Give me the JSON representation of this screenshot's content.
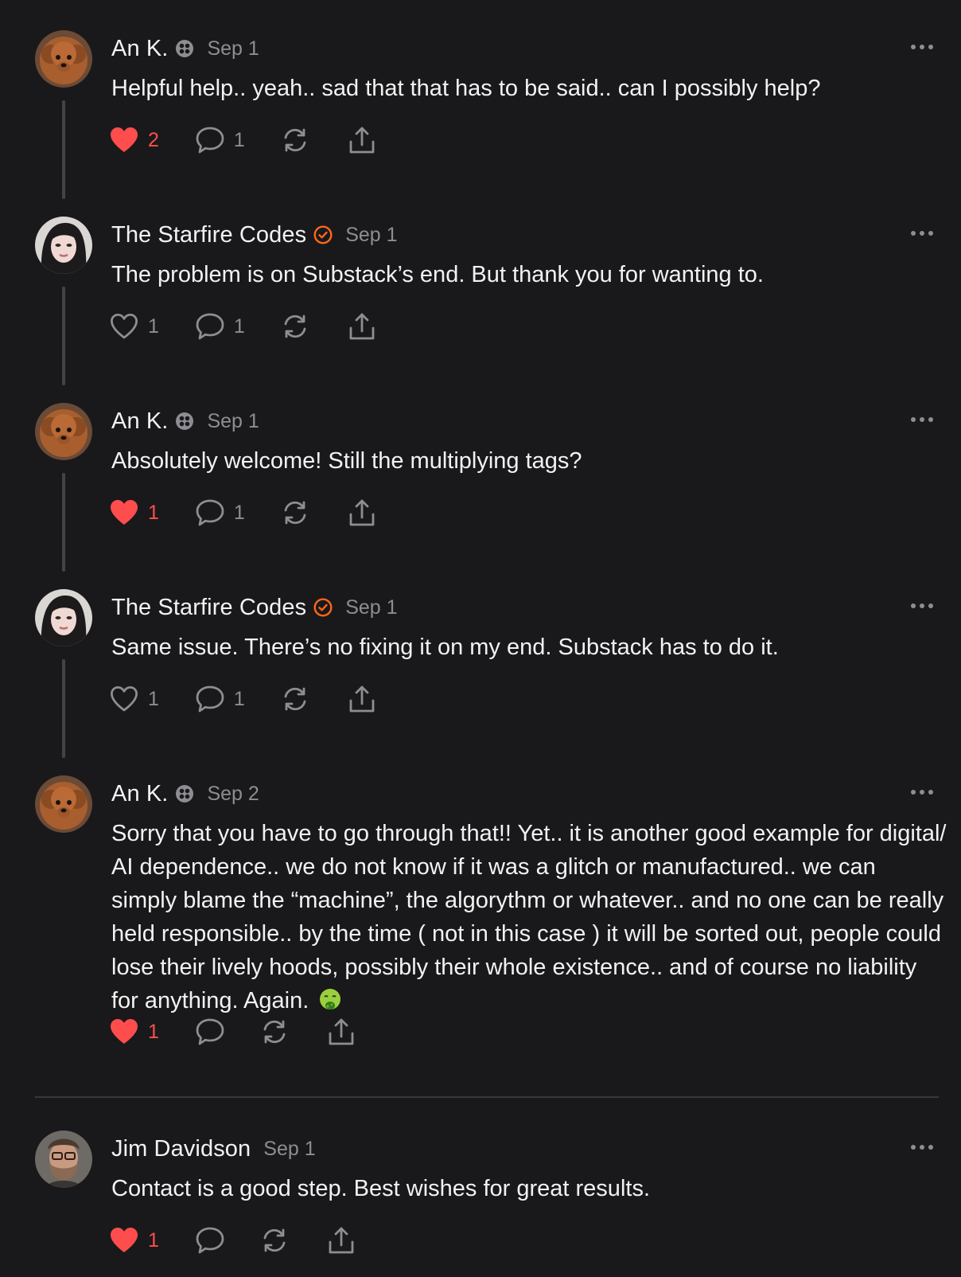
{
  "comments": [
    {
      "author": "An K.",
      "badge_icon": "pin-badge-icon",
      "date": "Sep 1",
      "text": "Helpful help.. yeah.. sad that that has to be said.. can I possibly help?",
      "likes": "2",
      "liked": true,
      "replies": "1",
      "avatar": "dog-avatar"
    },
    {
      "author": "The Starfire Codes",
      "badge_icon": "verified-check-icon",
      "date": "Sep 1",
      "text": "The problem is on Substack’s end. But thank you for wanting to.",
      "likes": "1",
      "liked": false,
      "replies": "1",
      "avatar": "woman-avatar"
    },
    {
      "author": "An K.",
      "badge_icon": "pin-badge-icon",
      "date": "Sep 1",
      "text": "Absolutely welcome! Still the multiplying tags?",
      "likes": "1",
      "liked": true,
      "replies": "1",
      "avatar": "dog-avatar"
    },
    {
      "author": "The Starfire Codes",
      "badge_icon": "verified-check-icon",
      "date": "Sep 1",
      "text": "Same issue. There’s no fixing it on my end. Substack has to do it.",
      "likes": "1",
      "liked": false,
      "replies": "1",
      "avatar": "woman-avatar"
    },
    {
      "author": "An K.",
      "badge_icon": "pin-badge-icon",
      "date": "Sep 2",
      "text": "Sorry that you have to go through that!! Yet.. it is another good example for digital/ AI dependence.. we do not know if it was a glitch or manufactured.. we can simply blame the “machine”, the algorythm or whatever.. and no one can be really held responsible.. by the time ( not in this case ) it will be sorted out, people could lose their lively hoods, possibly their whole existence.. and of course no liability for anything. Again.",
      "emoji": "nauseated-face-emoji",
      "likes": "1",
      "liked": true,
      "replies": "",
      "avatar": "dog-avatar"
    },
    {
      "author": "Jim Davidson",
      "badge_icon": "",
      "date": "Sep 1",
      "text": "Contact is a good step. Best wishes for great results.",
      "likes": "1",
      "liked": true,
      "replies": "",
      "avatar": "man-avatar"
    }
  ],
  "colors": {
    "background": "#19191b",
    "liked": "#ff4d4d",
    "muted": "#8d8d92",
    "verified": "#ff6719"
  }
}
